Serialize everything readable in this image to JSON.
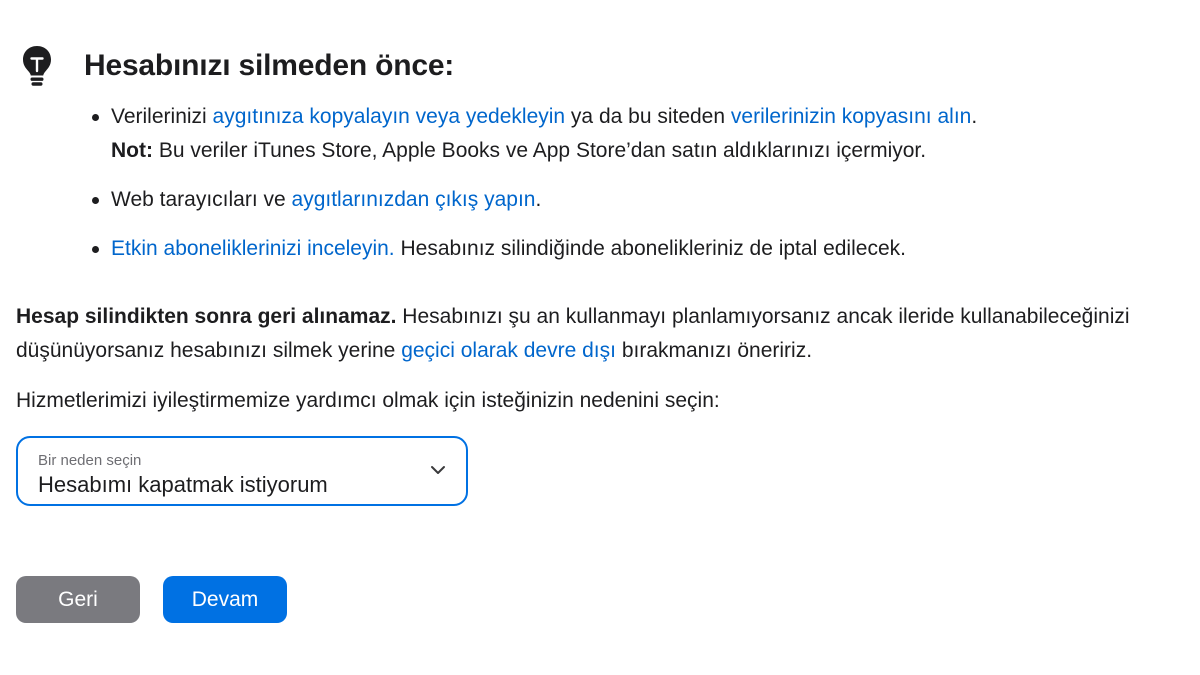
{
  "tip": {
    "icon": "lightbulb-icon",
    "title": "Hesabınızı silmeden önce:",
    "items": [
      {
        "pre": "Verilerinizi ",
        "link1": "aygıtınıza kopyalayın veya yedekleyin",
        "mid": " ya da bu siteden ",
        "link2": "verilerinizin kopyasını alın",
        "post": ".",
        "note_label": "Not:",
        "note_text": " Bu veriler iTunes Store, Apple Books ve App Store’dan satın aldıklarınızı içermiyor."
      },
      {
        "pre": "Web tarayıcıları ve ",
        "link": "aygıtlarınızdan çıkış yapın",
        "post": "."
      },
      {
        "link": "Etkin aboneliklerinizi inceleyin.",
        "post": " Hesabınız silindiğinde abonelikleriniz de iptal edilecek."
      }
    ]
  },
  "warning": {
    "bold": "Hesap silindikten sonra geri alınamaz.",
    "text1": " Hesabınızı şu an kullanmayı planlamıyorsanız ancak ileride kullanabileceğinizi",
    "text2": "düşünüyorsanız hesabınızı silmek yerine ",
    "link": "geçici olarak devre dışı",
    "text3": " bırakmanızı öneririz."
  },
  "prompt": "Hizmetlerimizi iyileştirmemize yardımcı olmak için isteğinizin nedenini seçin:",
  "reason_select": {
    "label": "Bir neden seçin",
    "value": "Hesabımı kapatmak istiyorum",
    "icon": "chevron-down-icon"
  },
  "buttons": {
    "back": "Geri",
    "continue": "Devam"
  },
  "colors": {
    "link": "#0066cc",
    "accent": "#0071e3",
    "back_button": "#7a7a7f",
    "text": "#1d1d1f"
  }
}
